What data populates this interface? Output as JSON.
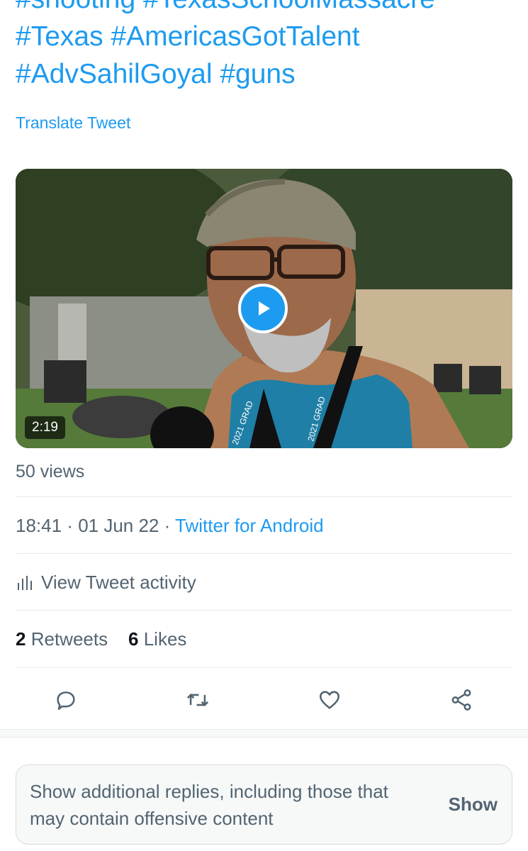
{
  "tweet": {
    "hashtag_lines": [
      "#shooting #TexasSchoolMassacre",
      "#Texas #AmericasGotTalent",
      "#AdvSahilGoyal #guns"
    ],
    "translate_label": "Translate Tweet"
  },
  "video": {
    "duration": "2:19",
    "play_icon": "play-icon",
    "lanyard_text": "2021 GRAD"
  },
  "views": "50 views",
  "meta": {
    "time": "18:41",
    "separator": " · ",
    "date": "01 Jun 22",
    "source": "Twitter for Android"
  },
  "activity": {
    "icon": "bar-chart-icon",
    "label": "View Tweet activity"
  },
  "stats": {
    "retweets_count": "2",
    "retweets_label": "Retweets",
    "likes_count": "6",
    "likes_label": "Likes"
  },
  "actions": {
    "reply_icon": "reply-icon",
    "retweet_icon": "retweet-icon",
    "like_icon": "heart-icon",
    "share_icon": "share-icon"
  },
  "replies_prompt": {
    "text": "Show additional replies, including those that may contain offensive content",
    "button_label": "Show"
  },
  "colors": {
    "accent": "#1d9bf0",
    "secondary_text": "#536471",
    "primary_text": "#0f1419"
  }
}
